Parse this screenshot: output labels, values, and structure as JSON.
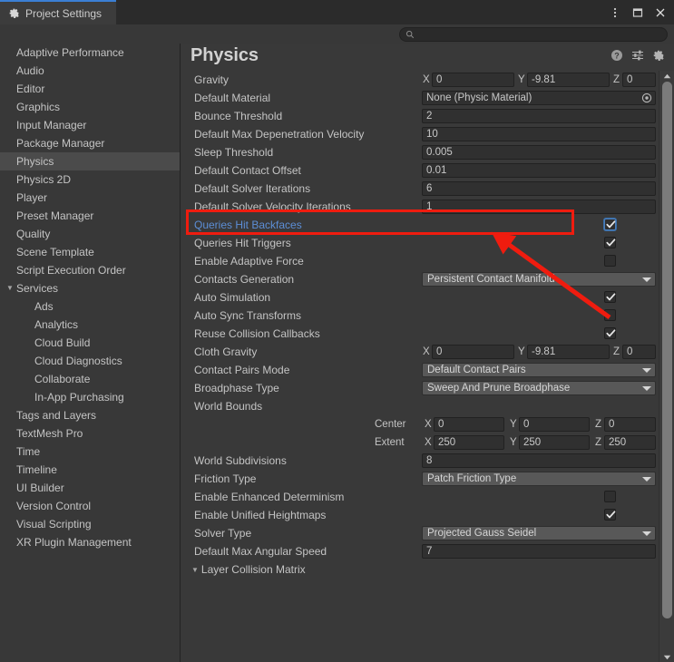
{
  "window": {
    "tab_label": "Project Settings",
    "tab_icon": "gear-icon",
    "controls": {
      "menu": "kebab-menu-icon",
      "maximize": "maximize-icon",
      "close": "close-icon"
    }
  },
  "search": {
    "placeholder": "",
    "value": "",
    "icon": "search-icon"
  },
  "sidebar": {
    "items": [
      {
        "label": "Adaptive Performance",
        "indent": 0,
        "selected": false,
        "caret": ""
      },
      {
        "label": "Audio",
        "indent": 0,
        "selected": false,
        "caret": ""
      },
      {
        "label": "Editor",
        "indent": 0,
        "selected": false,
        "caret": ""
      },
      {
        "label": "Graphics",
        "indent": 0,
        "selected": false,
        "caret": ""
      },
      {
        "label": "Input Manager",
        "indent": 0,
        "selected": false,
        "caret": ""
      },
      {
        "label": "Package Manager",
        "indent": 0,
        "selected": false,
        "caret": ""
      },
      {
        "label": "Physics",
        "indent": 0,
        "selected": true,
        "caret": ""
      },
      {
        "label": "Physics 2D",
        "indent": 0,
        "selected": false,
        "caret": ""
      },
      {
        "label": "Player",
        "indent": 0,
        "selected": false,
        "caret": ""
      },
      {
        "label": "Preset Manager",
        "indent": 0,
        "selected": false,
        "caret": ""
      },
      {
        "label": "Quality",
        "indent": 0,
        "selected": false,
        "caret": ""
      },
      {
        "label": "Scene Template",
        "indent": 0,
        "selected": false,
        "caret": ""
      },
      {
        "label": "Script Execution Order",
        "indent": 0,
        "selected": false,
        "caret": ""
      },
      {
        "label": "Services",
        "indent": 0,
        "selected": false,
        "caret": "▼"
      },
      {
        "label": "Ads",
        "indent": 1,
        "selected": false,
        "caret": ""
      },
      {
        "label": "Analytics",
        "indent": 1,
        "selected": false,
        "caret": ""
      },
      {
        "label": "Cloud Build",
        "indent": 1,
        "selected": false,
        "caret": ""
      },
      {
        "label": "Cloud Diagnostics",
        "indent": 1,
        "selected": false,
        "caret": ""
      },
      {
        "label": "Collaborate",
        "indent": 1,
        "selected": false,
        "caret": ""
      },
      {
        "label": "In-App Purchasing",
        "indent": 1,
        "selected": false,
        "caret": ""
      },
      {
        "label": "Tags and Layers",
        "indent": 0,
        "selected": false,
        "caret": ""
      },
      {
        "label": "TextMesh Pro",
        "indent": 0,
        "selected": false,
        "caret": ""
      },
      {
        "label": "Time",
        "indent": 0,
        "selected": false,
        "caret": ""
      },
      {
        "label": "Timeline",
        "indent": 0,
        "selected": false,
        "caret": ""
      },
      {
        "label": "UI Builder",
        "indent": 0,
        "selected": false,
        "caret": ""
      },
      {
        "label": "Version Control",
        "indent": 0,
        "selected": false,
        "caret": ""
      },
      {
        "label": "Visual Scripting",
        "indent": 0,
        "selected": false,
        "caret": ""
      },
      {
        "label": "XR Plugin Management",
        "indent": 0,
        "selected": false,
        "caret": ""
      }
    ]
  },
  "main": {
    "title": "Physics",
    "header_icons": [
      {
        "name": "help-icon"
      },
      {
        "name": "preset-icon"
      },
      {
        "name": "gear-icon"
      }
    ],
    "rows": {
      "gravity": {
        "label": "Gravity",
        "x_label": "X",
        "x_value": "0",
        "y_label": "Y",
        "y_value": "-9.81",
        "z_label": "Z",
        "z_value": "0"
      },
      "default_material": {
        "label": "Default Material",
        "value": "None (Physic Material)",
        "picker_icon": "object-picker-icon"
      },
      "bounce_threshold": {
        "label": "Bounce Threshold",
        "value": "2"
      },
      "default_max_depenetration_velocity": {
        "label": "Default Max Depenetration Velocity",
        "value": "10"
      },
      "sleep_threshold": {
        "label": "Sleep Threshold",
        "value": "0.005"
      },
      "default_contact_offset": {
        "label": "Default Contact Offset",
        "value": "0.01"
      },
      "default_solver_iterations": {
        "label": "Default Solver Iterations",
        "value": "6"
      },
      "default_solver_velocity_iterations": {
        "label": "Default Solver Velocity Iterations",
        "value": "1"
      },
      "queries_hit_backfaces": {
        "label": "Queries Hit Backfaces",
        "checked": true,
        "highlighted": true
      },
      "queries_hit_triggers": {
        "label": "Queries Hit Triggers",
        "checked": true
      },
      "enable_adaptive_force": {
        "label": "Enable Adaptive Force",
        "checked": false
      },
      "contacts_generation": {
        "label": "Contacts Generation",
        "value": "Persistent Contact Manifold"
      },
      "auto_simulation": {
        "label": "Auto Simulation",
        "checked": true
      },
      "auto_sync_transforms": {
        "label": "Auto Sync Transforms",
        "checked": false
      },
      "reuse_collision_callbacks": {
        "label": "Reuse Collision Callbacks",
        "checked": true
      },
      "cloth_gravity": {
        "label": "Cloth Gravity",
        "x_label": "X",
        "x_value": "0",
        "y_label": "Y",
        "y_value": "-9.81",
        "z_label": "Z",
        "z_value": "0"
      },
      "contact_pairs_mode": {
        "label": "Contact Pairs Mode",
        "value": "Default Contact Pairs"
      },
      "broadphase_type": {
        "label": "Broadphase Type",
        "value": "Sweep And Prune Broadphase"
      },
      "world_bounds": {
        "label": "World Bounds"
      },
      "world_bounds_center": {
        "label": "Center",
        "x_label": "X",
        "x_value": "0",
        "y_label": "Y",
        "y_value": "0",
        "z_label": "Z",
        "z_value": "0"
      },
      "world_bounds_extent": {
        "label": "Extent",
        "x_label": "X",
        "x_value": "250",
        "y_label": "Y",
        "y_value": "250",
        "z_label": "Z",
        "z_value": "250"
      },
      "world_subdivisions": {
        "label": "World Subdivisions",
        "value": "8"
      },
      "friction_type": {
        "label": "Friction Type",
        "value": "Patch Friction Type"
      },
      "enable_enhanced_determinism": {
        "label": "Enable Enhanced Determinism",
        "checked": false
      },
      "enable_unified_heightmaps": {
        "label": "Enable Unified Heightmaps",
        "checked": true
      },
      "solver_type": {
        "label": "Solver Type",
        "value": "Projected Gauss Seidel"
      },
      "default_max_angular_speed": {
        "label": "Default Max Angular Speed",
        "value": "7"
      },
      "layer_collision_matrix": {
        "label": "Layer Collision Matrix",
        "caret": "▼"
      }
    }
  },
  "annotation": {
    "highlight_color": "#ef1c0f",
    "arrow_color": "#ef1c0f",
    "box_target": "Queries Hit Backfaces"
  },
  "colors": {
    "accent_blue": "#3b7fd4",
    "link_blue": "#5c8ed6",
    "panel_bg": "#393939",
    "sidebar_bg": "#383838",
    "selection_bg": "#4b4b4b"
  }
}
